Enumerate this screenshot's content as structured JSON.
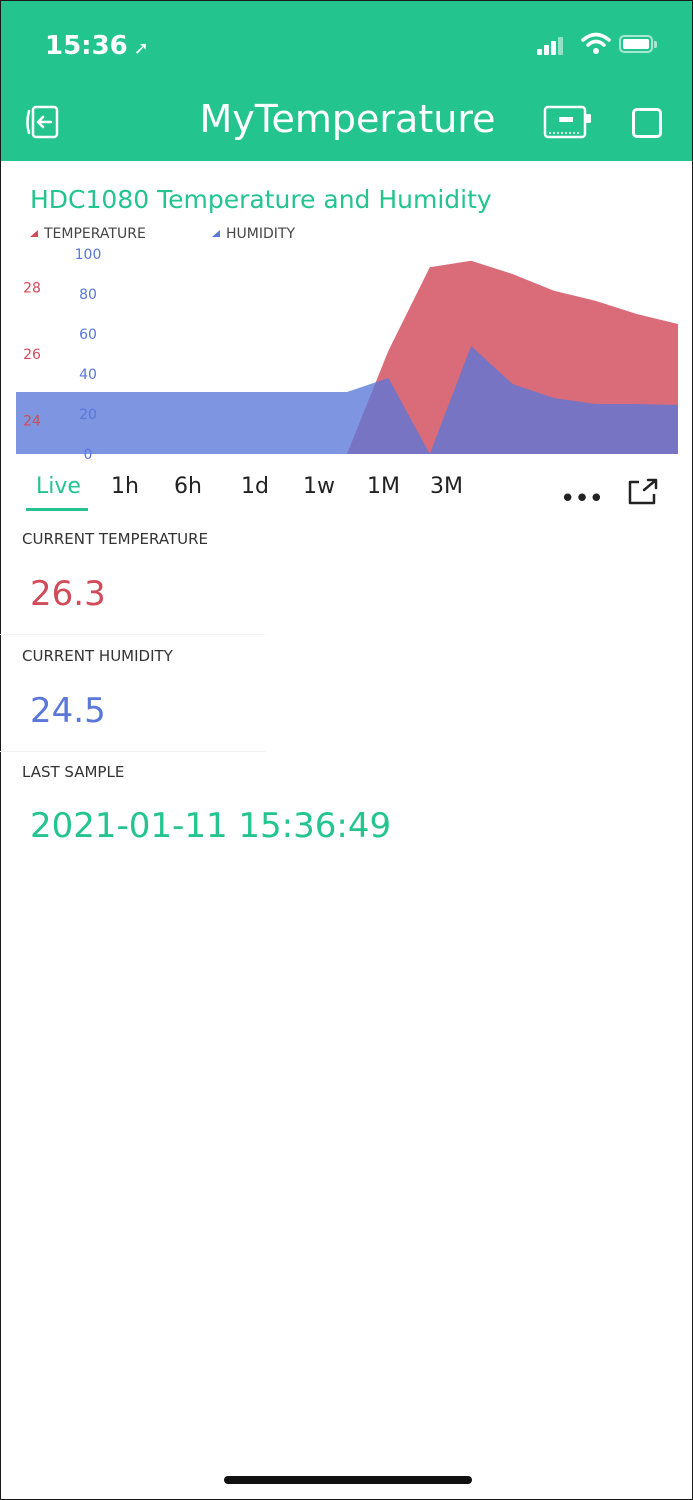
{
  "status_bar": {
    "time": "15:36",
    "location_arrow": "location-arrow-icon"
  },
  "header": {
    "title": "MyTemperature"
  },
  "chart": {
    "title": "HDC1080 Temperature and Humidity",
    "legend": {
      "temperature": "TEMPERATURE",
      "humidity": "HUMIDITY"
    }
  },
  "chart_data": {
    "type": "area",
    "title": "HDC1080 Temperature and Humidity",
    "legend_position": "top-left",
    "grid": false,
    "axes": [
      {
        "side": "left-outer",
        "color": "#d24b5a",
        "range": [
          23,
          29
        ],
        "ticks": [
          24,
          26,
          28
        ]
      },
      {
        "side": "left-inner",
        "color": "#5a77d9",
        "range": [
          0,
          100
        ],
        "ticks": [
          0,
          20,
          40,
          60,
          80,
          100
        ]
      }
    ],
    "x": [
      0,
      1,
      2,
      3,
      4,
      5,
      6,
      7,
      8,
      9,
      10,
      11,
      12,
      13,
      14,
      15,
      16
    ],
    "series": [
      {
        "name": "TEMPERATURE",
        "color": "#d24b5a",
        "axis": 0,
        "values": [
          23.0,
          23.0,
          23.0,
          23.0,
          23.0,
          23.0,
          23.0,
          23.0,
          23.0,
          26.1,
          28.6,
          28.8,
          28.4,
          27.9,
          27.6,
          27.2,
          26.9
        ]
      },
      {
        "name": "HUMIDITY",
        "color": "#5a77d9",
        "axis": 1,
        "values": [
          31,
          31,
          31,
          31,
          31,
          31,
          31,
          31,
          31,
          38,
          0,
          54,
          35,
          28,
          25,
          25,
          24.5
        ]
      }
    ]
  },
  "time_tabs": [
    "Live",
    "1h",
    "6h",
    "1d",
    "1w",
    "1M",
    "3M"
  ],
  "current_temperature": {
    "label": "CURRENT TEMPERATURE",
    "value": "26.3",
    "color": "#d24b5a"
  },
  "current_humidity": {
    "label": "CURRENT HUMIDITY",
    "value": "24.5",
    "color": "#5a77d9"
  },
  "last_sample": {
    "label": "LAST SAMPLE",
    "value": "2021-01-11 15:36:49",
    "color": "#23c48e"
  },
  "colors": {
    "accent": "#23c48e",
    "temperature": "#d24b5a",
    "humidity": "#5a77d9"
  },
  "icons": {
    "back": "exit-device-icon",
    "device": "device-icon",
    "stop": "stop-icon",
    "more": "more-dots-icon",
    "export": "export-icon"
  }
}
